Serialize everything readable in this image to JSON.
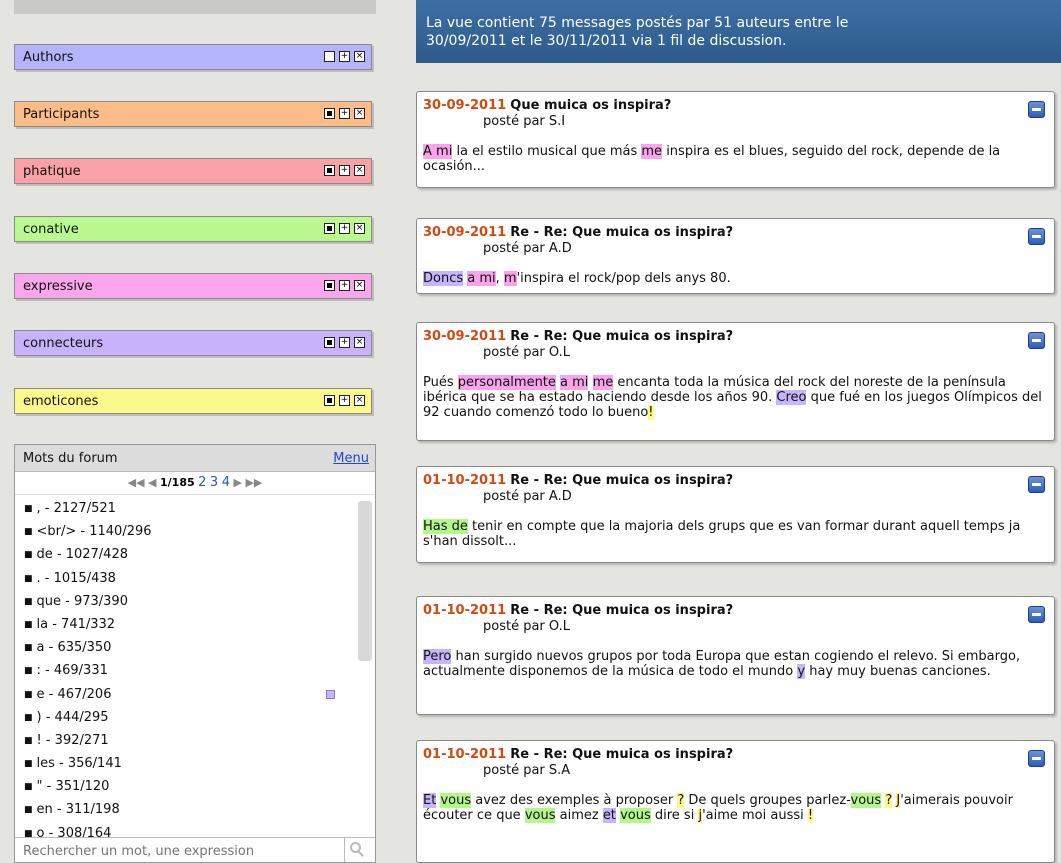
{
  "categories": [
    {
      "label": "Authors",
      "color": "#b4b4fc"
    },
    {
      "label": "Participants",
      "color": "#fcbd88"
    },
    {
      "label": "phatique",
      "color": "#f9a1a7"
    },
    {
      "label": "conative",
      "color": "#baf990"
    },
    {
      "label": "expressive",
      "color": "#f9a6ec"
    },
    {
      "label": "connecteurs",
      "color": "#c6b3fb"
    },
    {
      "label": "emoticones",
      "color": "#fbf98b"
    }
  ],
  "mots": {
    "title": "Mots du forum",
    "menu": "Menu",
    "pager": {
      "current": "1",
      "total": "/185",
      "pages": [
        "2",
        "3",
        "4"
      ]
    },
    "words": [
      ", - 2127/521",
      "<br/> - 1140/296",
      "de - 1027/428",
      ". - 1015/438",
      "que - 973/390",
      "la - 741/332",
      "a - 635/350",
      ": - 469/331",
      "e - 467/206",
      ") - 444/295",
      "! - 392/271",
      "les - 356/141",
      "\" - 351/120",
      "en - 311/198",
      "o - 308/164"
    ],
    "search_placeholder": "Rechercher un mot, une expression"
  },
  "info": {
    "line1": "La vue contient 75 messages postés par 51 auteurs entre le",
    "line2": "30/09/2011 et le 30/11/2011 via 1 fil de discussion."
  },
  "posts": [
    {
      "date": "30-09-2011",
      "title": "Que muica os inspira?",
      "by": "posté par S.I",
      "body": [
        [
          "A mi",
          "hp"
        ],
        [
          " la el estilo musical que más ",
          ""
        ],
        [
          "me",
          "hp"
        ],
        [
          " inspira es el blues, seguido del rock, depende de la ocasión...",
          ""
        ]
      ]
    },
    {
      "date": "30-09-2011",
      "title": "Re - Re: Que muica os inspira?",
      "by": "posté par A.D",
      "body": [
        [
          "Doncs",
          "hv"
        ],
        [
          " ",
          ""
        ],
        [
          "a mi",
          "hp"
        ],
        [
          ", ",
          ""
        ],
        [
          "m",
          "hp"
        ],
        [
          "'inspira el rock/pop dels anys 80.",
          ""
        ]
      ]
    },
    {
      "date": "30-09-2011",
      "title": "Re - Re: Que muica os inspira?",
      "by": "posté par O.L",
      "body": [
        [
          "Pués ",
          ""
        ],
        [
          "personalmente",
          "hp"
        ],
        [
          " ",
          ""
        ],
        [
          "a mi",
          "hp"
        ],
        [
          " ",
          ""
        ],
        [
          "me",
          "hp"
        ],
        [
          " encanta toda la música del rock del noreste de la península ibérica que se ha estado haciendo desde los años 90. ",
          ""
        ],
        [
          "Creo",
          "hv"
        ],
        [
          " que fué en los juegos Olímpicos del 92 cuando comenzó todo lo bueno",
          ""
        ],
        [
          "!",
          "hy"
        ]
      ]
    },
    {
      "date": "01-10-2011",
      "title": "Re - Re: Que muica os inspira?",
      "by": "posté par A.D",
      "body": [
        [
          "Has de",
          "hg"
        ],
        [
          " tenir en compte que la majoria dels grups que es van formar durant aquell temps ja s'han dissolt...",
          ""
        ]
      ]
    },
    {
      "date": "01-10-2011",
      "title": "Re - Re: Que muica os inspira?",
      "by": "posté par O.L",
      "body": [
        [
          "Pero",
          "hv"
        ],
        [
          " han surgido nuevos grupos por toda Europa que estan cogiendo el relevo. Si embargo, actualmente disponemos de la música de todo el mundo ",
          ""
        ],
        [
          "y",
          "hv"
        ],
        [
          " hay muy buenas canciones.",
          ""
        ]
      ]
    },
    {
      "date": "01-10-2011",
      "title": "Re - Re: Que muica os inspira?",
      "by": "posté par S.A",
      "body": [
        [
          "Et",
          "hv"
        ],
        [
          " ",
          ""
        ],
        [
          "vous",
          "hg"
        ],
        [
          " avez des exemples à proposer ",
          ""
        ],
        [
          "?",
          "hy"
        ],
        [
          " De quels groupes parlez-",
          ""
        ],
        [
          "vous",
          "hg"
        ],
        [
          " ",
          ""
        ],
        [
          "?",
          "hy"
        ],
        [
          " ",
          ""
        ],
        [
          "J",
          "hy"
        ],
        [
          "'aimerais pouvoir écouter ce que ",
          ""
        ],
        [
          "vous",
          "hg"
        ],
        [
          " aimez ",
          ""
        ],
        [
          "et",
          "hv"
        ],
        [
          " ",
          ""
        ],
        [
          "vous",
          "hg"
        ],
        [
          " dire si ",
          ""
        ],
        [
          "j",
          "hy"
        ],
        [
          "'aime moi aussi ",
          ""
        ],
        [
          "!",
          "hy"
        ]
      ]
    }
  ]
}
